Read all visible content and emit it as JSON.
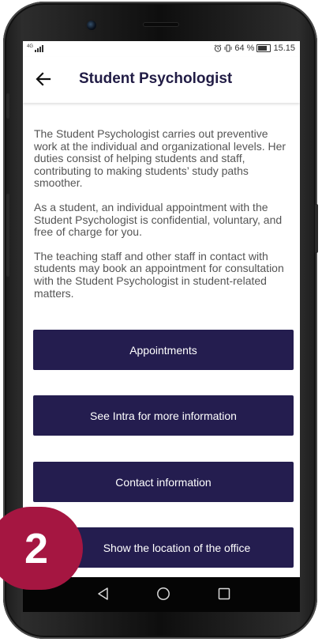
{
  "status_bar": {
    "network": "4G",
    "battery_percent": "64 %",
    "time": "15.15"
  },
  "header": {
    "back_icon": "arrow-left-icon",
    "title": "Student Psychologist"
  },
  "body": {
    "paragraphs": [
      "The Student Psychologist carries out preventive work at the individual and organizational levels. Her duties consist of helping students and staff, contributing to making students’ study paths smoother.",
      "As a student, an individual appointment with the Student Psychologist is confidential, voluntary, and free of charge for you.",
      "The teaching staff and other staff in contact with students may book an appointment for consultation with the Student Psychologist in student-related matters."
    ]
  },
  "actions": [
    {
      "label": "Appointments"
    },
    {
      "label": "See Intra for more information"
    },
    {
      "label": "Contact information"
    },
    {
      "label": "Show the location of the office"
    }
  ],
  "nav_bar": {
    "back_icon": "triangle-back-icon",
    "home_icon": "circle-home-icon",
    "recents_icon": "square-recents-icon"
  },
  "step_badge": {
    "number": "2"
  },
  "colors": {
    "button_bg": "#241d4f",
    "title": "#211c45",
    "badge": "#a51641"
  }
}
